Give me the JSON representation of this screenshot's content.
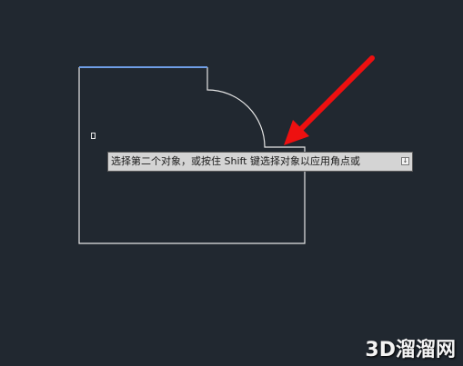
{
  "command_tooltip": {
    "text": "选择第二个对象，或按住 Shift 键选择对象以应用角点或",
    "expand_glyph": "↓"
  },
  "watermark": {
    "text": "3D溜溜网"
  },
  "colors": {
    "background": "#212830",
    "geometry": "#e6e6e6",
    "selected_edge": "#6f9ee6",
    "arrow": "#ee1010"
  },
  "icons": {
    "pickbox": "pickbox-cursor-icon",
    "arrow": "red-arrow-icon",
    "expand": "expand-arrow-icon"
  }
}
